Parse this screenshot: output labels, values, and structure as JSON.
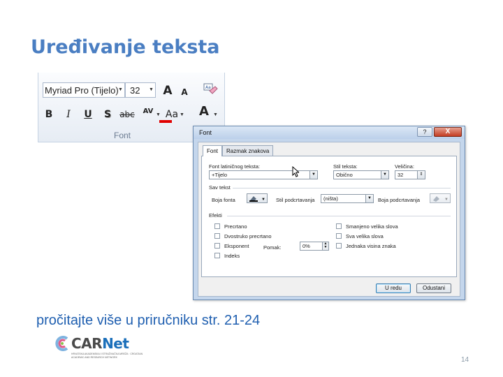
{
  "slide": {
    "title": "Uređivanje teksta",
    "read_more": "pročitajte više u priručniku str.  21-24",
    "page_number": "14",
    "accent_color": "#4a7ec2",
    "text_color": "#1f5fb0"
  },
  "ribbon": {
    "font_name": "Myriad Pro (Tijelo)",
    "font_size": "32",
    "grow_font_icon": "A",
    "shrink_font_icon": "A",
    "clear_format_icon": "clear-formatting-icon",
    "bold": "B",
    "italic": "I",
    "underline": "U",
    "shadow": "S",
    "strikethrough": "abc",
    "spacing": "AV",
    "change_case": "Aa",
    "font_color": "A",
    "group_label": "Font",
    "font_color_hex": "#e00000"
  },
  "dialog": {
    "title": "Font",
    "help": "?",
    "close": "X",
    "tabs": [
      "Font",
      "Razmak znakova"
    ],
    "font_latin_label": "Font latiničnog teksta:",
    "font_latin_value": "+Tijelo",
    "style_label": "Stil teksta:",
    "style_value": "Obično",
    "size_label": "Veličina:",
    "size_value": "32",
    "all_text_label": "Sav tekst",
    "font_color_label": "Boja fonta",
    "underline_style_label": "Stil podcrtavanja",
    "underline_style_value": "(ništa)",
    "underline_color_label": "Boja podcrtavanja",
    "effects_label": "Efekti",
    "effects_left": [
      "Precrtano",
      "Dvostruko precrtano",
      "Eksponent",
      "Indeks"
    ],
    "offset_label": "Pomak:",
    "offset_value": "0%",
    "effects_right": [
      "Smanjeno velika slova",
      "Sva velika slova",
      "Jednaka visina znaka"
    ],
    "ok": "U redu",
    "cancel": "Odustani"
  },
  "logo": {
    "name_part1": "CAR",
    "name_part2": "Net",
    "subtitle": "HRVATSKA AKADEMSKA I ISTRAŽIVAČKA MREŽA · CROATIAN ACADEMIC AND RESEARCH NETWORK"
  }
}
